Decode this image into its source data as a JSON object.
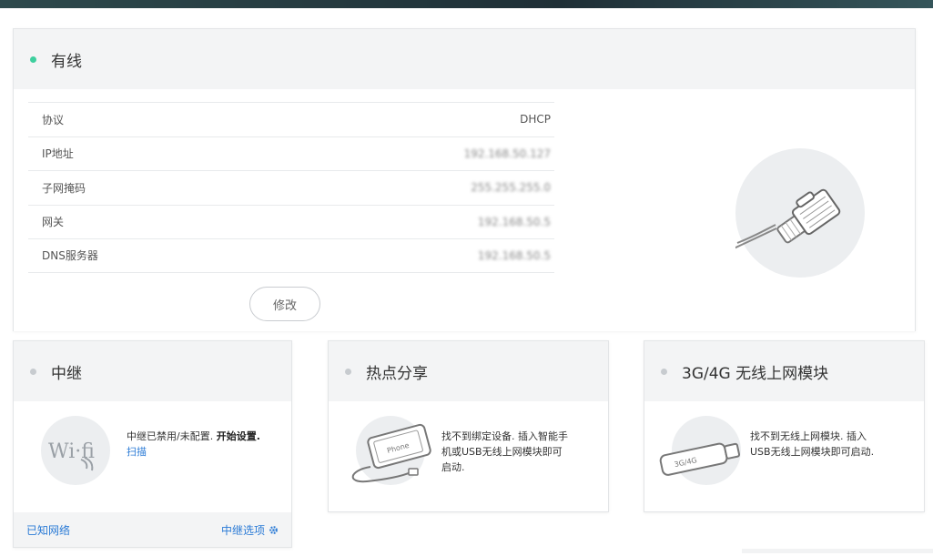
{
  "wired": {
    "title": "有线",
    "status_color": "#3ecf9e",
    "rows": [
      {
        "label": "协议",
        "value": "DHCP"
      },
      {
        "label": "IP地址",
        "value": "192.168.50.127"
      },
      {
        "label": "子网掩码",
        "value": "255.255.255.0"
      },
      {
        "label": "网关",
        "value": "192.168.50.5"
      },
      {
        "label": "DNS服务器",
        "value": "192.168.50.5"
      }
    ],
    "modify_label": "修改",
    "illustration_icon": "ethernet-cable-icon"
  },
  "relay": {
    "title": "中继",
    "text_prefix": "中继已禁用/未配置.",
    "text_bold": "开始设置.",
    "scan_link": "扫描",
    "illustration_icon": "wifi-icon",
    "footer_left": "已知网络",
    "footer_right": "中继选项",
    "footer_icon": "gear-icon"
  },
  "hotspot": {
    "title": "热点分享",
    "text": "找不到绑定设备. 插入智能手机或USB无线上网模块即可启动.",
    "illustration_icon": "phone-usb-icon",
    "phone_label": "Phone"
  },
  "mobile": {
    "title": "3G/4G 无线上网模块",
    "text": "找不到无线上网模块. 插入USB无线上网模块即可启动.",
    "illustration_icon": "usb-modem-icon",
    "modem_label": "3G/4G"
  }
}
